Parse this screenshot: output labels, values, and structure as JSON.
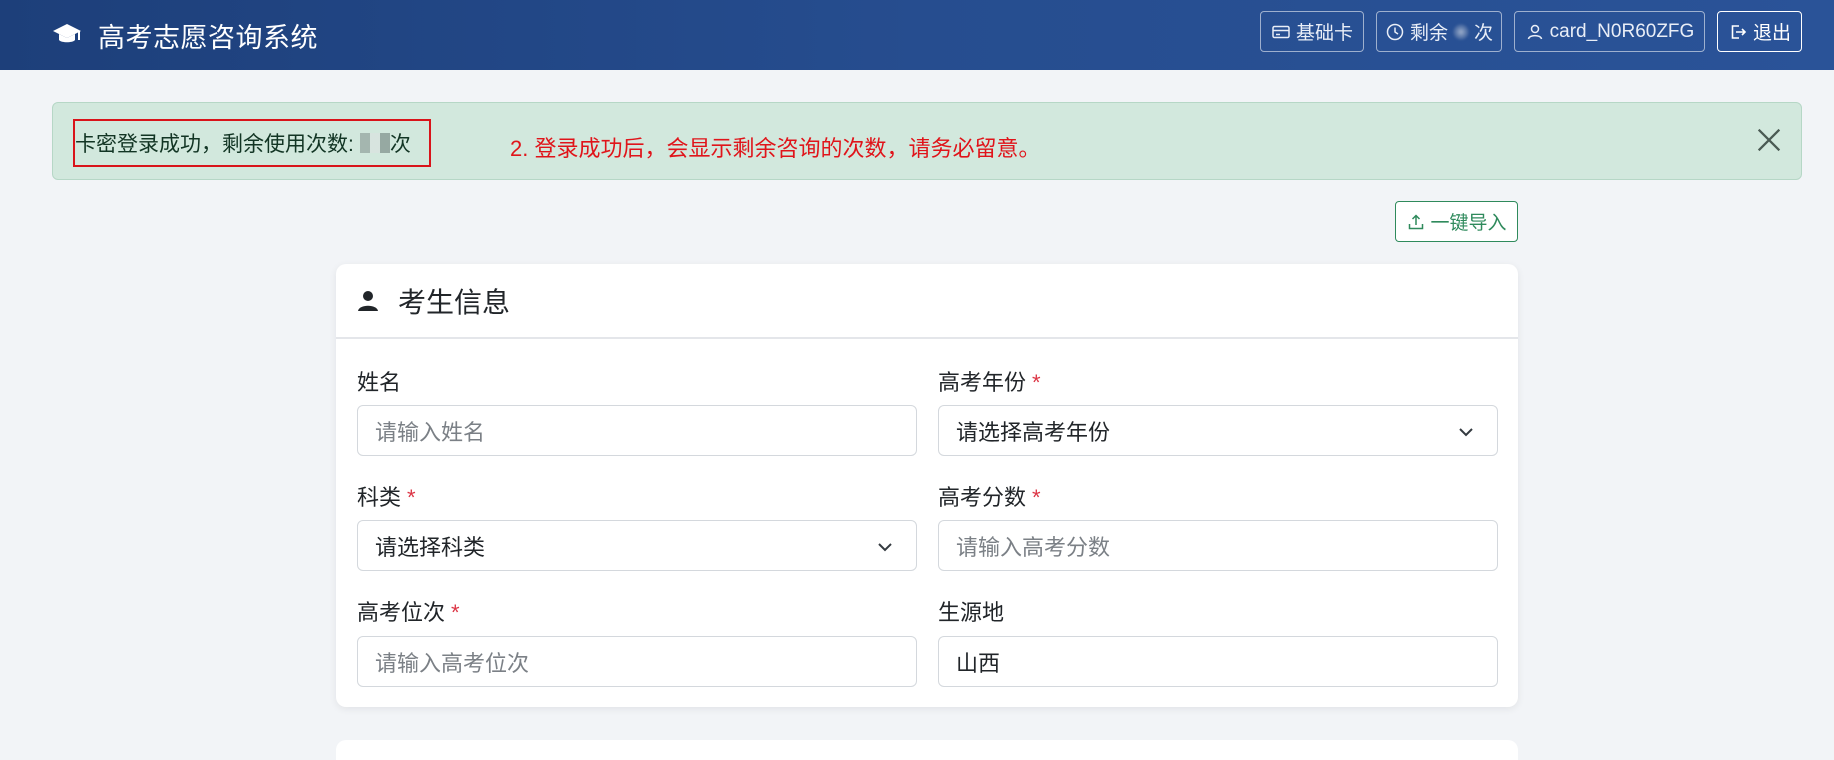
{
  "header": {
    "title": "高考志愿咨询系统",
    "card_type_label": "基础卡",
    "remaining_prefix": "剩余",
    "remaining_suffix": "次",
    "card_id": "card_N0R60ZFG",
    "logout_label": "退出"
  },
  "alert": {
    "message_prefix": "卡密登录成功，剩余使用次数: ",
    "message_suffix": "次",
    "annotation": "2. 登录成功后，会显示剩余咨询的次数，请务必留意。"
  },
  "toolbar": {
    "import_label": "一键导入"
  },
  "card": {
    "title": "考生信息",
    "fields": {
      "name": {
        "label": "姓名",
        "placeholder": "请输入姓名"
      },
      "year": {
        "label": "高考年份",
        "required": "*",
        "value": "请选择高考年份"
      },
      "subject": {
        "label": "科类",
        "required": "*",
        "value": "请选择科类"
      },
      "score": {
        "label": "高考分数",
        "required": "*",
        "placeholder": "请输入高考分数"
      },
      "rank": {
        "label": "高考位次",
        "required": "*",
        "placeholder": "请输入高考位次"
      },
      "origin": {
        "label": "生源地",
        "value": "山西"
      }
    }
  },
  "colors": {
    "navbar": "#264d8f",
    "alert_bg": "#d2e8dd",
    "highlight_border": "#d9141a",
    "annotation": "#e0141a",
    "required": "#dc3545",
    "import_btn": "#2f8a5c"
  },
  "icons": [
    "graduation-cap-icon",
    "card-icon",
    "clock-icon",
    "user-icon",
    "logout-icon",
    "close-icon",
    "upload-icon",
    "person-icon",
    "chevron-down-icon"
  ]
}
